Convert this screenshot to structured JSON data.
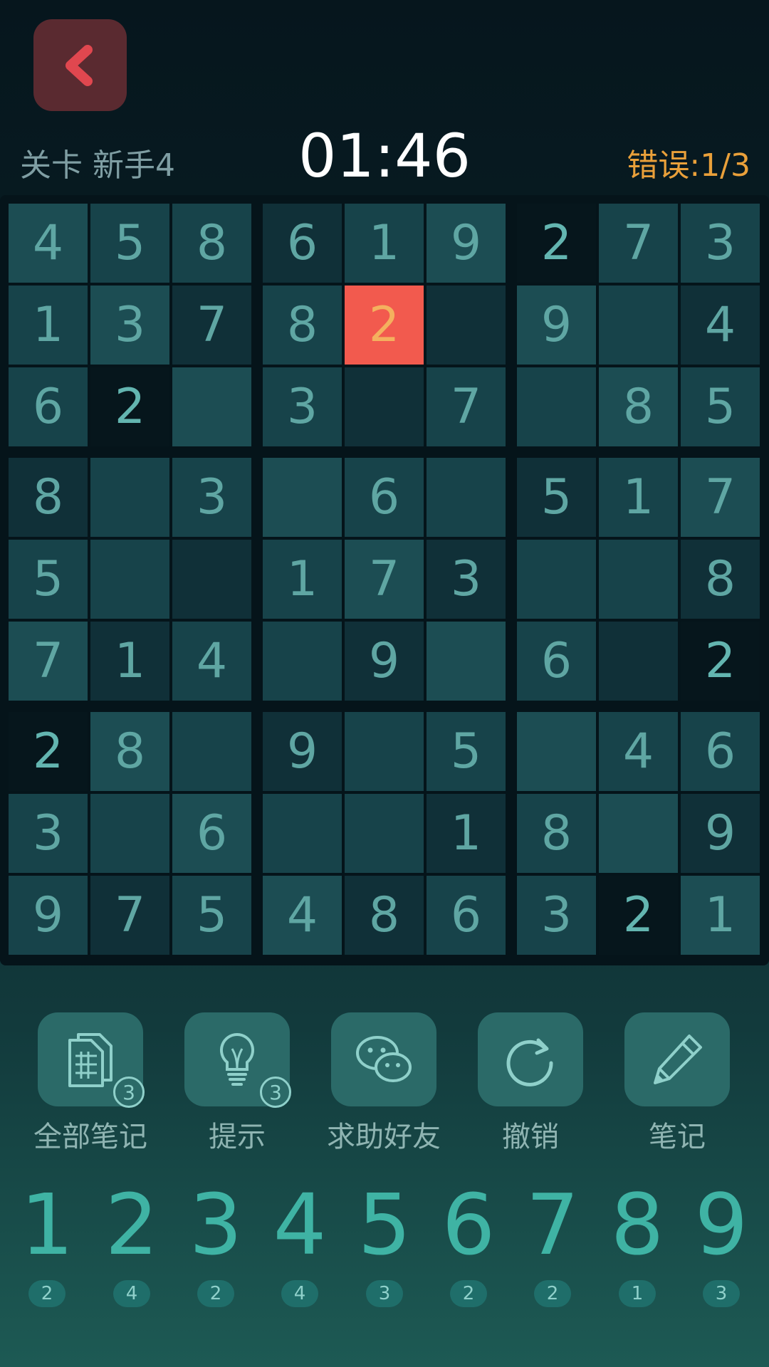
{
  "header": {
    "level": "关卡 新手4",
    "timer": "01:46",
    "errors_label": "错误:",
    "errors_value": "1/3"
  },
  "board": {
    "rows": [
      [
        "4",
        "5",
        "8",
        "6",
        "1",
        "9",
        "2",
        "7",
        "3"
      ],
      [
        "1",
        "3",
        "7",
        "8",
        "2",
        "",
        "9",
        "",
        "4"
      ],
      [
        "6",
        "2",
        "",
        "3",
        "",
        "7",
        "",
        "8",
        "5"
      ],
      [
        "8",
        "",
        "3",
        "",
        "6",
        "",
        "5",
        "1",
        "7"
      ],
      [
        "5",
        "",
        "",
        "1",
        "7",
        "3",
        "",
        "",
        "8"
      ],
      [
        "7",
        "1",
        "4",
        "",
        "9",
        "",
        "6",
        "",
        "2"
      ],
      [
        "2",
        "8",
        "",
        "9",
        "",
        "5",
        "",
        "4",
        "6"
      ],
      [
        "3",
        "",
        "6",
        "",
        "",
        "1",
        "8",
        "",
        "9"
      ],
      [
        "9",
        "7",
        "5",
        "4",
        "8",
        "6",
        "3",
        "2",
        "1"
      ]
    ],
    "highlighted_digit": "2",
    "error_cell": [
      1,
      4
    ],
    "colors": {
      "cell_shade_a": "#17434a",
      "cell_shade_b": "#1c4d53",
      "cell_shade_c": "#103038",
      "highlight_bg": "#06161c",
      "error_bg": "#f25a4e",
      "error_text": "#f4b05e",
      "digit": "#5fa6a3"
    }
  },
  "tools": [
    {
      "name": "all-notes",
      "label": "全部笔记",
      "icon": "notes-grid-icon",
      "badge": "3"
    },
    {
      "name": "hint",
      "label": "提示",
      "icon": "lightbulb-icon",
      "badge": "3"
    },
    {
      "name": "ask-friend",
      "label": "求助好友",
      "icon": "wechat-icon",
      "badge": ""
    },
    {
      "name": "undo",
      "label": "撤销",
      "icon": "undo-icon",
      "badge": ""
    },
    {
      "name": "note",
      "label": "笔记",
      "icon": "pencil-icon",
      "badge": ""
    }
  ],
  "numpad": [
    {
      "digit": "1",
      "remaining": "2"
    },
    {
      "digit": "2",
      "remaining": "4"
    },
    {
      "digit": "3",
      "remaining": "2"
    },
    {
      "digit": "4",
      "remaining": "4"
    },
    {
      "digit": "5",
      "remaining": "3"
    },
    {
      "digit": "6",
      "remaining": "2"
    },
    {
      "digit": "7",
      "remaining": "2"
    },
    {
      "digit": "8",
      "remaining": "1"
    },
    {
      "digit": "9",
      "remaining": "3"
    }
  ],
  "icons": {
    "back": "chevron-left-icon"
  },
  "accent_colors": {
    "back_button": "#5a2a30",
    "back_chevron": "#e0474f",
    "errors": "#e9a03a",
    "numpad_digit": "#3fb3a4"
  }
}
